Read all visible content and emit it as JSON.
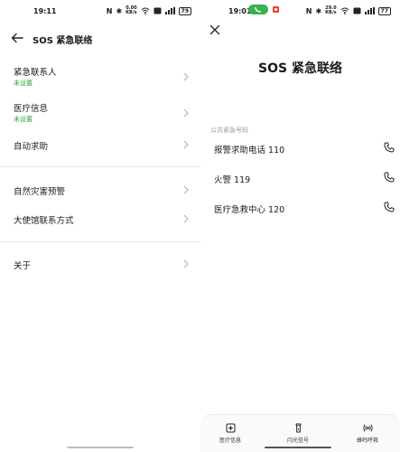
{
  "left": {
    "status": {
      "time": "19:11",
      "battery": "79",
      "net_speed": "0.00\nKB/s"
    },
    "header": {
      "title": "SOS 紧急联络"
    },
    "menu": [
      {
        "label": "紧急联系人",
        "sub": "未设置"
      },
      {
        "label": "医疗信息",
        "sub": "未设置"
      },
      {
        "label": "自动求助"
      },
      {
        "label": "自然灾害预警"
      },
      {
        "label": "大使馆联系方式"
      },
      {
        "label": "关于"
      }
    ]
  },
  "right": {
    "status": {
      "time": "19:01",
      "battery": "77",
      "net_speed": "29.0\nKB/s"
    },
    "title": "SOS 紧急联络",
    "section_label": "公共紧急号码",
    "contacts": [
      {
        "name": "报警求助电话 110"
      },
      {
        "name": "火警 119"
      },
      {
        "name": "医疗急救中心 120"
      }
    ],
    "tabs": [
      {
        "label": "医疗信息",
        "icon": "medical-info-icon"
      },
      {
        "label": "闪光信号",
        "icon": "flashlight-icon"
      },
      {
        "label": "蜂鸣呼救",
        "icon": "alarm-sound-icon"
      }
    ]
  },
  "colors": {
    "accent_green": "#2aa33a",
    "status_chip_green": "#37b34a",
    "status_dot_red": "#e8413a",
    "icon_gray": "#b5b5b5",
    "text": "#1a1a1a"
  }
}
